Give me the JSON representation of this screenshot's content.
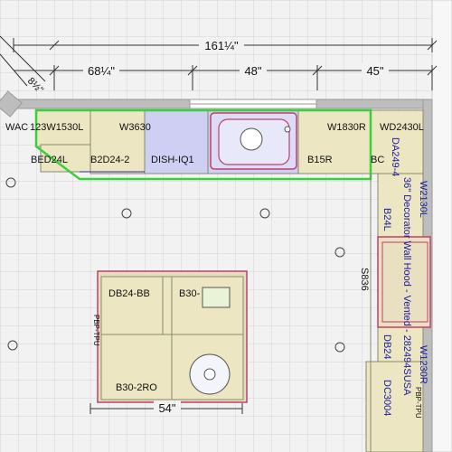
{
  "dimensions": {
    "overall": "161¼\"",
    "seg_left": "68¼\"",
    "seg_mid": "48\"",
    "seg_right": "45\"",
    "island_width": "54\"",
    "corner_small": "8½\""
  },
  "labels": {
    "wac": "WAC",
    "w1530l": "123W1530L",
    "w3630": "W3630",
    "w1830r": "W1830R",
    "wd2430l": "WD2430L",
    "bed24l": "BED24L",
    "b2d24": "B2D24-2",
    "dish": "DISH-IQ1",
    "b15r": "B15R",
    "bc": "BC",
    "w2130l": "W2130L",
    "b24l": "B24L",
    "s836": "S836",
    "w1230r": "W1230R",
    "db24_bb": "DB24-BB",
    "b30_1": "B30-",
    "b30_2ro": "B30-2RO",
    "hood_top": "DA249-4",
    "hood_text": "36\" Decorator Wall Hood - Vented - 282494SUSA",
    "db24_side": "DB24",
    "dc3004": "DC3004",
    "pbp_left": "PBP-TPU",
    "pbp_right": "PBP-TPU"
  },
  "colors": {
    "background": "#f2f2f2",
    "grid": "#d6d6d6",
    "wall": "#b9b9b9",
    "cabinet": "#ece6c2",
    "selection": "#3ccf3c",
    "cabinet_edge": "#c0406a",
    "appliance": "#cfcff4"
  }
}
